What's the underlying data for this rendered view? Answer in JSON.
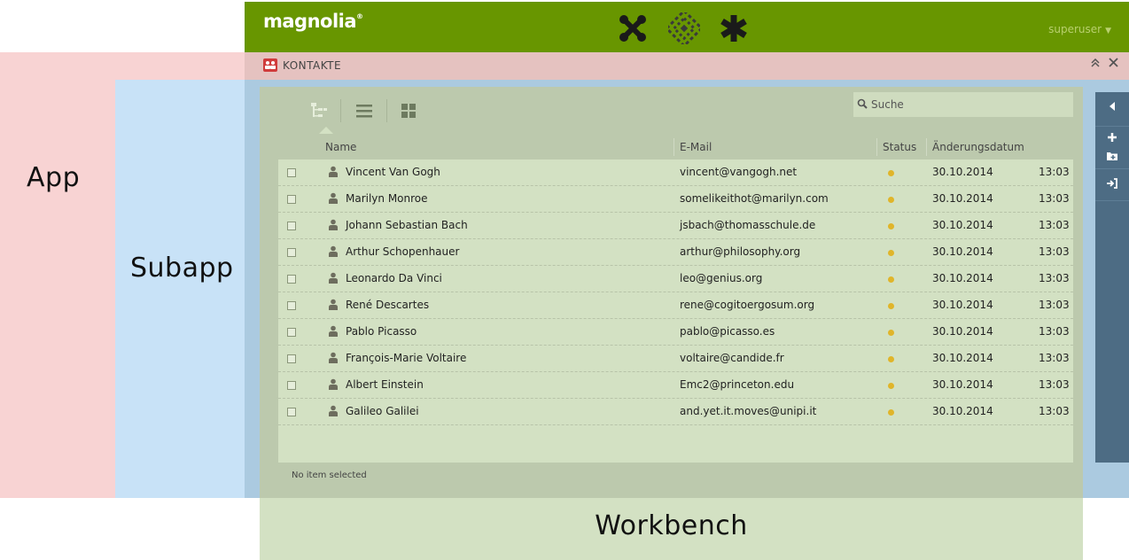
{
  "labels": {
    "app": "App",
    "subapp": "Subapp",
    "workbench": "Workbench"
  },
  "header": {
    "logo_text": "magnolia",
    "logo_mark": "®",
    "icons": [
      "apps-launcher-icon",
      "pulse-icon",
      "favorites-icon"
    ],
    "user": "superuser",
    "brand_color": "#689600"
  },
  "app_tab": {
    "icon": "contacts-icon",
    "title": "KONTAKTE",
    "maximize_icon": "maximize-icon",
    "close_icon": "close-icon"
  },
  "workbench": {
    "views": [
      "tree-view-icon",
      "list-view-icon",
      "thumbnail-view-icon"
    ],
    "search": {
      "placeholder": "Suche"
    },
    "columns": {
      "name": "Name",
      "email": "E-Mail",
      "status": "Status",
      "modified": "Änderungsdatum"
    },
    "rows": [
      {
        "name": "Vincent Van Gogh",
        "email": "vincent@vangogh.net",
        "date": "30.10.2014",
        "time": "13:03"
      },
      {
        "name": "Marilyn Monroe",
        "email": "somelikeithot@marilyn.com",
        "date": "30.10.2014",
        "time": "13:03"
      },
      {
        "name": "Johann Sebastian Bach",
        "email": "jsbach@thomasschule.de",
        "date": "30.10.2014",
        "time": "13:03"
      },
      {
        "name": "Arthur Schopenhauer",
        "email": "arthur@philosophy.org",
        "date": "30.10.2014",
        "time": "13:03"
      },
      {
        "name": "Leonardo Da Vinci",
        "email": "leo@genius.org",
        "date": "30.10.2014",
        "time": "13:03"
      },
      {
        "name": "René Descartes",
        "email": "rene@cogitoergosum.org",
        "date": "30.10.2014",
        "time": "13:03"
      },
      {
        "name": "Pablo Picasso",
        "email": "pablo@picasso.es",
        "date": "30.10.2014",
        "time": "13:03"
      },
      {
        "name": "François-Marie Voltaire",
        "email": "voltaire@candide.fr",
        "date": "30.10.2014",
        "time": "13:03"
      },
      {
        "name": "Albert Einstein",
        "email": "Emc2@princeton.edu",
        "date": "30.10.2014",
        "time": "13:03"
      },
      {
        "name": "Galileo Galilei",
        "email": "and.yet.it.moves@unipi.it",
        "date": "30.10.2014",
        "time": "13:03"
      }
    ],
    "status_color": "#e0b52a",
    "status_text": "No item selected"
  },
  "action_bar": {
    "items": [
      "collapse-icon",
      "add-contact-icon",
      "add-folder-icon",
      "import-icon"
    ]
  },
  "colors": {
    "app_overlay": "#f8d3d3",
    "subapp_overlay": "#c8e2f7",
    "workbench_overlay": "#d3e1c3",
    "action_bar": "#4d6c84"
  }
}
